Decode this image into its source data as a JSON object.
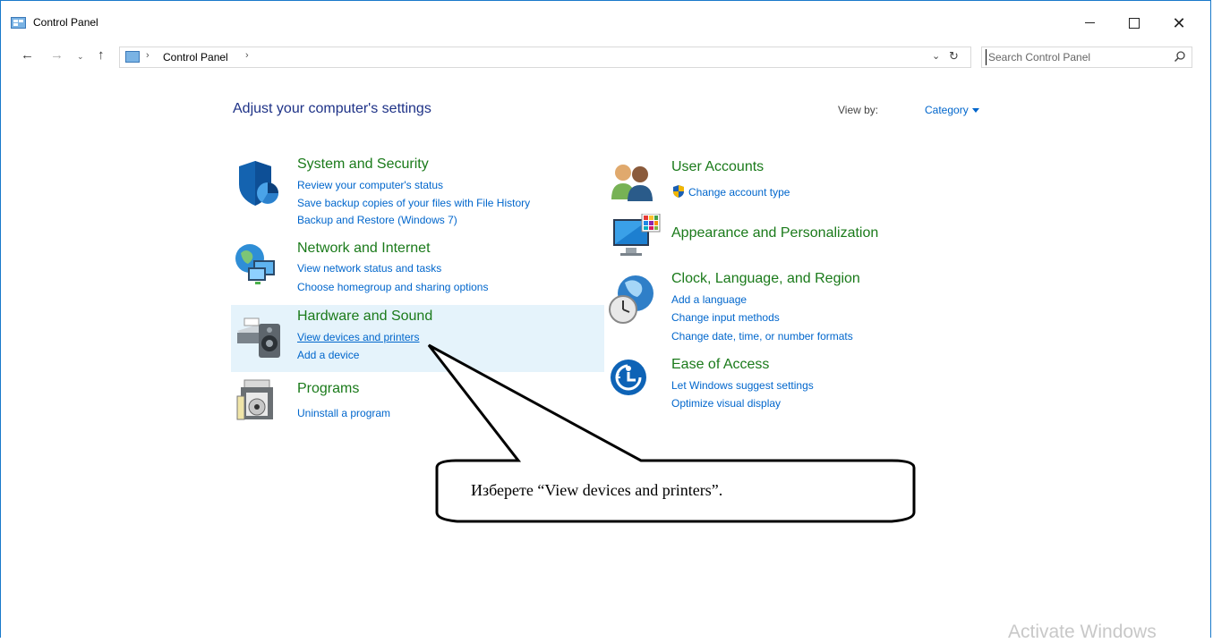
{
  "window": {
    "title": "Control Panel",
    "minimize_label": "—",
    "close_label": "✕"
  },
  "nav": {
    "back": "←",
    "forward": "→",
    "recent": "⌄",
    "up": "↑",
    "breadcrumb_sep": "›",
    "breadcrumb": "Control Panel",
    "breadcrumb_sep2": "›",
    "dropdown": "⌄",
    "refresh": "↻"
  },
  "search": {
    "placeholder": "Search Control Panel"
  },
  "main": {
    "heading": "Adjust your computer's settings",
    "view_by_label": "View by:",
    "view_by_value": "Category"
  },
  "categories_left": [
    {
      "title": "System and Security",
      "links": [
        "Review your computer's status",
        "Save backup copies of your files with File History",
        "Backup and Restore (Windows 7)"
      ]
    },
    {
      "title": "Network and Internet",
      "links": [
        "View network status and tasks",
        "Choose homegroup and sharing options"
      ]
    },
    {
      "title": "Hardware and Sound",
      "links": [
        "View devices and printers",
        "Add a device"
      ]
    },
    {
      "title": "Programs",
      "links": [
        "Uninstall a program"
      ]
    }
  ],
  "categories_right": [
    {
      "title": "User Accounts",
      "links": [
        "Change account type"
      ]
    },
    {
      "title": "Appearance and Personalization",
      "links": []
    },
    {
      "title": "Clock, Language, and Region",
      "links": [
        "Add a language",
        "Change input methods",
        "Change date, time, or number formats"
      ]
    },
    {
      "title": "Ease of Access",
      "links": [
        "Let Windows suggest settings",
        "Optimize visual display"
      ]
    }
  ],
  "callout": {
    "text": "Изберете “View devices and printers”."
  },
  "watermark": "Activate Windows",
  "colors": {
    "category_title": "#1a7a1a",
    "link": "#0066cc",
    "heading": "#1e3287",
    "hover_bg": "#e5f3fb"
  }
}
